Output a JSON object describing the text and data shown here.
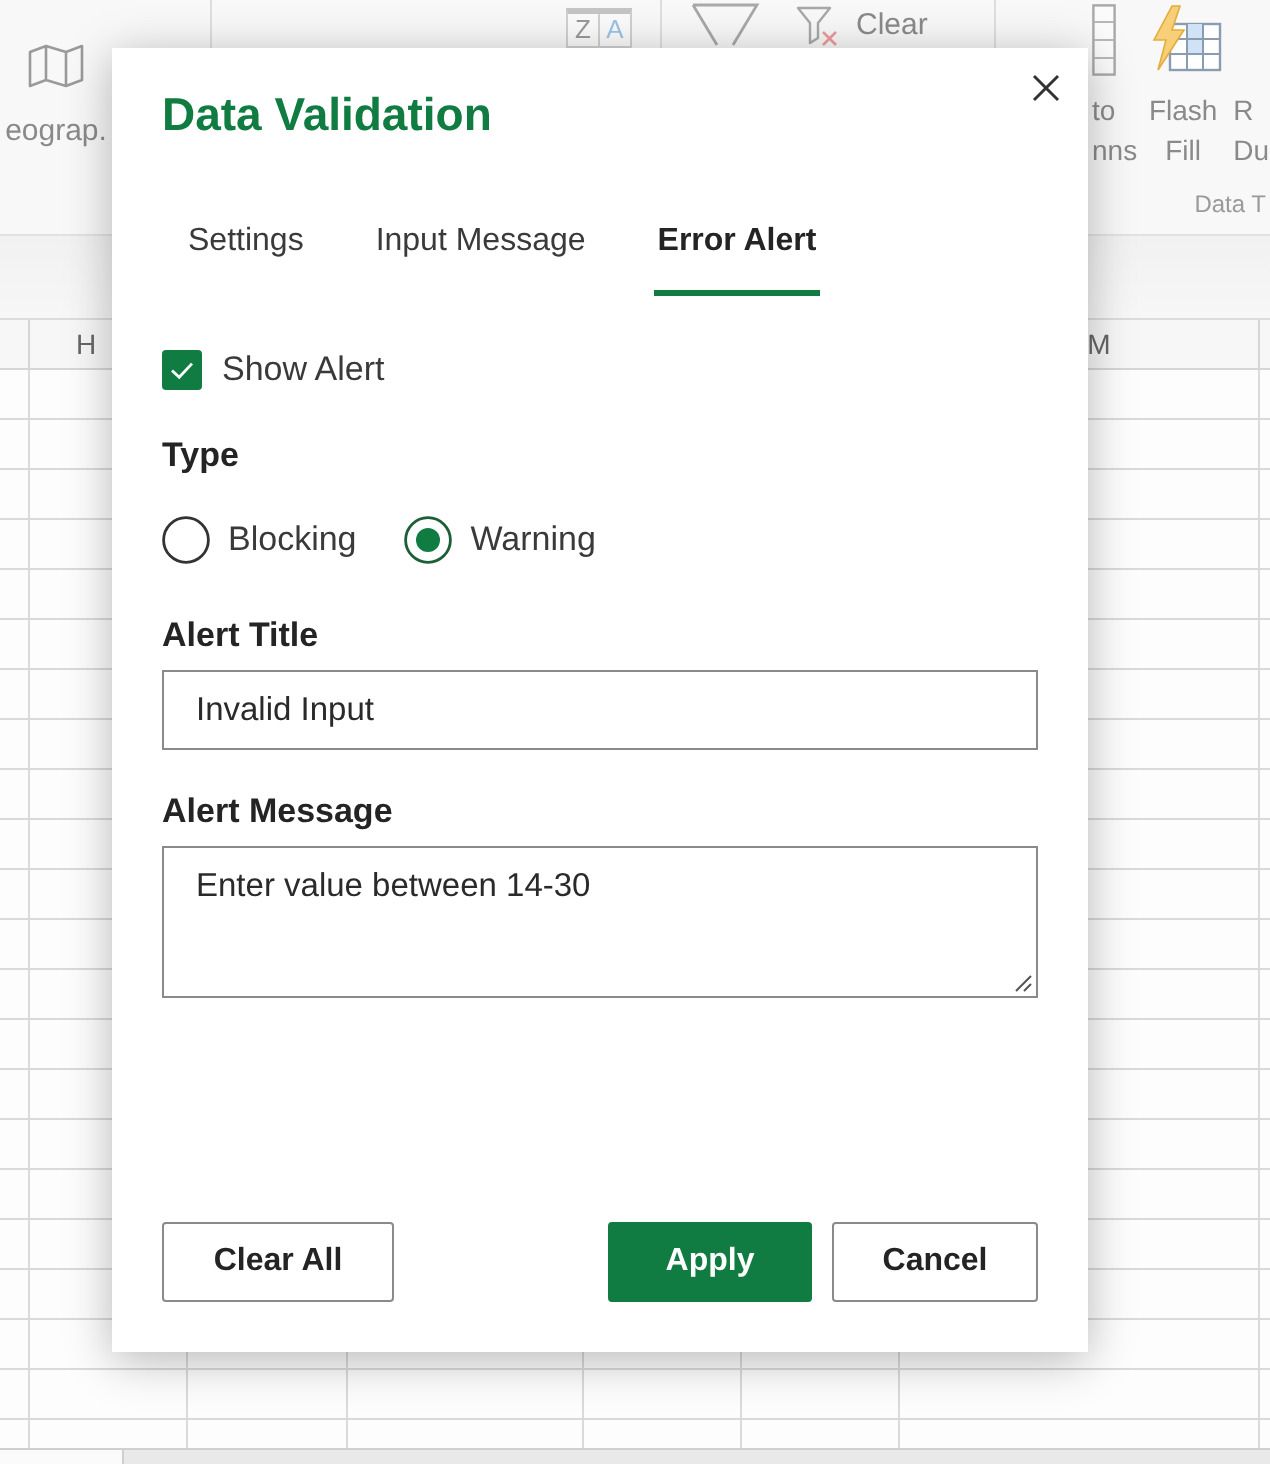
{
  "ribbon": {
    "map_button": {
      "label": "eograp."
    },
    "sort_button": {
      "letters": [
        "Z",
        "A"
      ]
    },
    "clear_button": {
      "label": "Clear"
    },
    "right_buttons": [
      {
        "kind": "columns",
        "lines": [
          "to",
          "nns"
        ]
      },
      {
        "kind": "flash",
        "lines": [
          "Flash",
          "Fill"
        ]
      },
      {
        "kind": "plain",
        "lines": [
          "R",
          "Du"
        ]
      }
    ],
    "group_label": "Data T"
  },
  "sheet": {
    "column_headers": [
      "H",
      "M"
    ]
  },
  "dialog": {
    "title": "Data Validation",
    "tabs": [
      {
        "label": "Settings",
        "selected": false
      },
      {
        "label": "Input Message",
        "selected": false
      },
      {
        "label": "Error Alert",
        "selected": true
      }
    ],
    "show_alert": {
      "label": "Show Alert",
      "checked": true
    },
    "type": {
      "label": "Type",
      "options": [
        {
          "label": "Blocking",
          "selected": false
        },
        {
          "label": "Warning",
          "selected": true
        }
      ]
    },
    "alert_title": {
      "label": "Alert Title",
      "value": "Invalid Input"
    },
    "alert_message": {
      "label": "Alert Message",
      "value": "Enter value between 14-30"
    },
    "footer": {
      "left_buttons": [
        {
          "label": "Clear All",
          "kind": "secondary"
        }
      ],
      "right_buttons": [
        {
          "label": "Apply",
          "kind": "primary"
        },
        {
          "label": "Cancel",
          "kind": "secondary"
        }
      ]
    }
  }
}
